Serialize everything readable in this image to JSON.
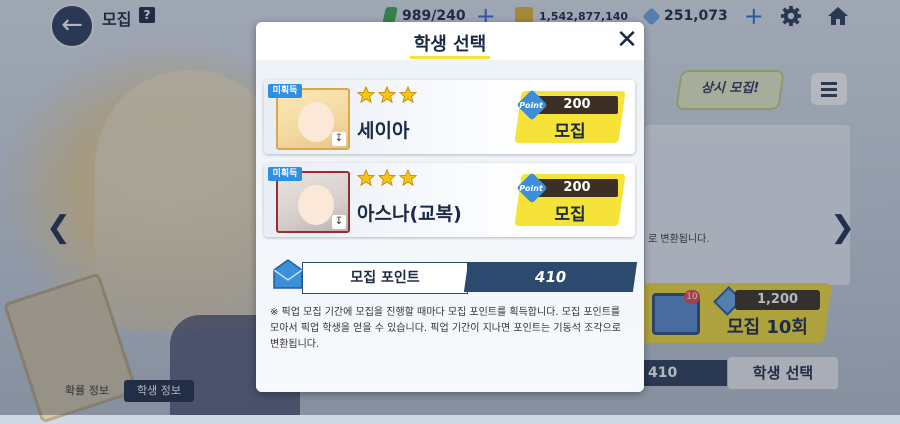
{
  "top_bar": {
    "title": "모집",
    "help": "?",
    "ap": "989/240",
    "credits": "1,542,877,140",
    "gems": "251,073",
    "plus": "+"
  },
  "background": {
    "banner_badge": "상시 모집!",
    "side_text": "로 변환됩니다.",
    "recruit10_cost": "1,200",
    "recruit10_label": "모집 10회",
    "recruit10_badge": "10",
    "bottom_points": "410",
    "bottom_select": "학생 선택",
    "tab_rates": "확률 정보",
    "tab_students": "학생 정보"
  },
  "modal": {
    "title": "학생 선택",
    "students": [
      {
        "tag": "미획득",
        "stars": 3,
        "name": "세이아",
        "cost": "200",
        "button": "모집"
      },
      {
        "tag": "미획득",
        "stars": 3,
        "name": "아스나(교복)",
        "cost": "200",
        "button": "모집"
      }
    ],
    "point_icon_label": "Point",
    "points_label": "모집 포인트",
    "points_value": "410",
    "notice": "※ 픽업 모집 기간에 모집을 진행할 때마다 모집 포인트를 획득합니다. 모집 포인트를 모아서 픽업 학생을 얻을 수 있습니다. 픽업 기간이 지나면 포인트는 기동석 조각으로 변환됩니다."
  },
  "colors": {
    "accent_yellow": "#f6e33a",
    "navy": "#2b4a6d",
    "tag_blue": "#2f8fe0"
  }
}
